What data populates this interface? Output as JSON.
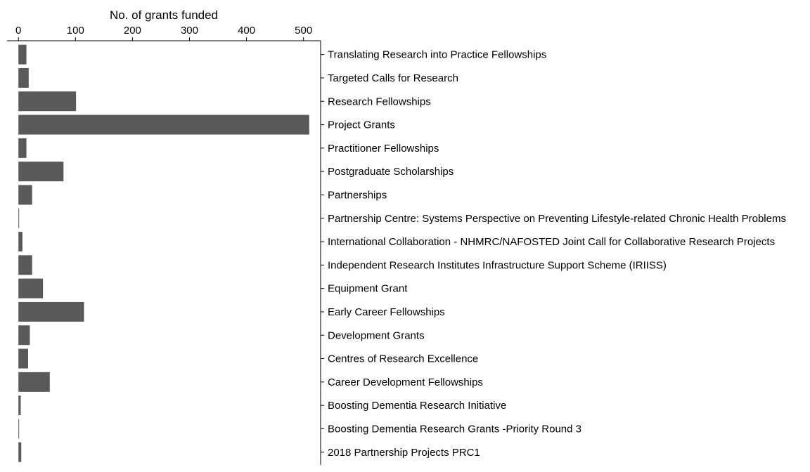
{
  "chart_data": {
    "type": "bar",
    "orientation": "horizontal",
    "xlabel": "No. of grants funded",
    "xlim": [
      -20,
      530
    ],
    "xticks": [
      0,
      100,
      200,
      300,
      400,
      500
    ],
    "categories": [
      "Translating Research into Practice Fellowships",
      "Targeted Calls for Research",
      "Research Fellowships",
      "Project Grants",
      "Practitioner Fellowships",
      "Postgraduate Scholarships",
      "Partnerships",
      "Partnership Centre: Systems Perspective on Preventing Lifestyle-related Chronic Health Problems",
      "International Collaboration - NHMRC/NAFOSTED Joint Call for Collaborative Research Projects",
      "Independent Research Institutes Infrastructure Support Scheme (IRIISS)",
      "Equipment Grant",
      "Early Career Fellowships",
      "Development Grants",
      "Centres of Research Excellence",
      "Career Development Fellowships",
      "Boosting Dementia Research Initiative",
      "Boosting Dementia Research Grants -Priority Round 3",
      "2018 Partnership Projects PRC1"
    ],
    "values": [
      14,
      18,
      101,
      510,
      14,
      79,
      24,
      1,
      7,
      24,
      43,
      115,
      20,
      17,
      55,
      4,
      1,
      5
    ],
    "bar_color": "#595959",
    "axis_location": "top-x, right-y",
    "grid": false,
    "legend": "none"
  }
}
